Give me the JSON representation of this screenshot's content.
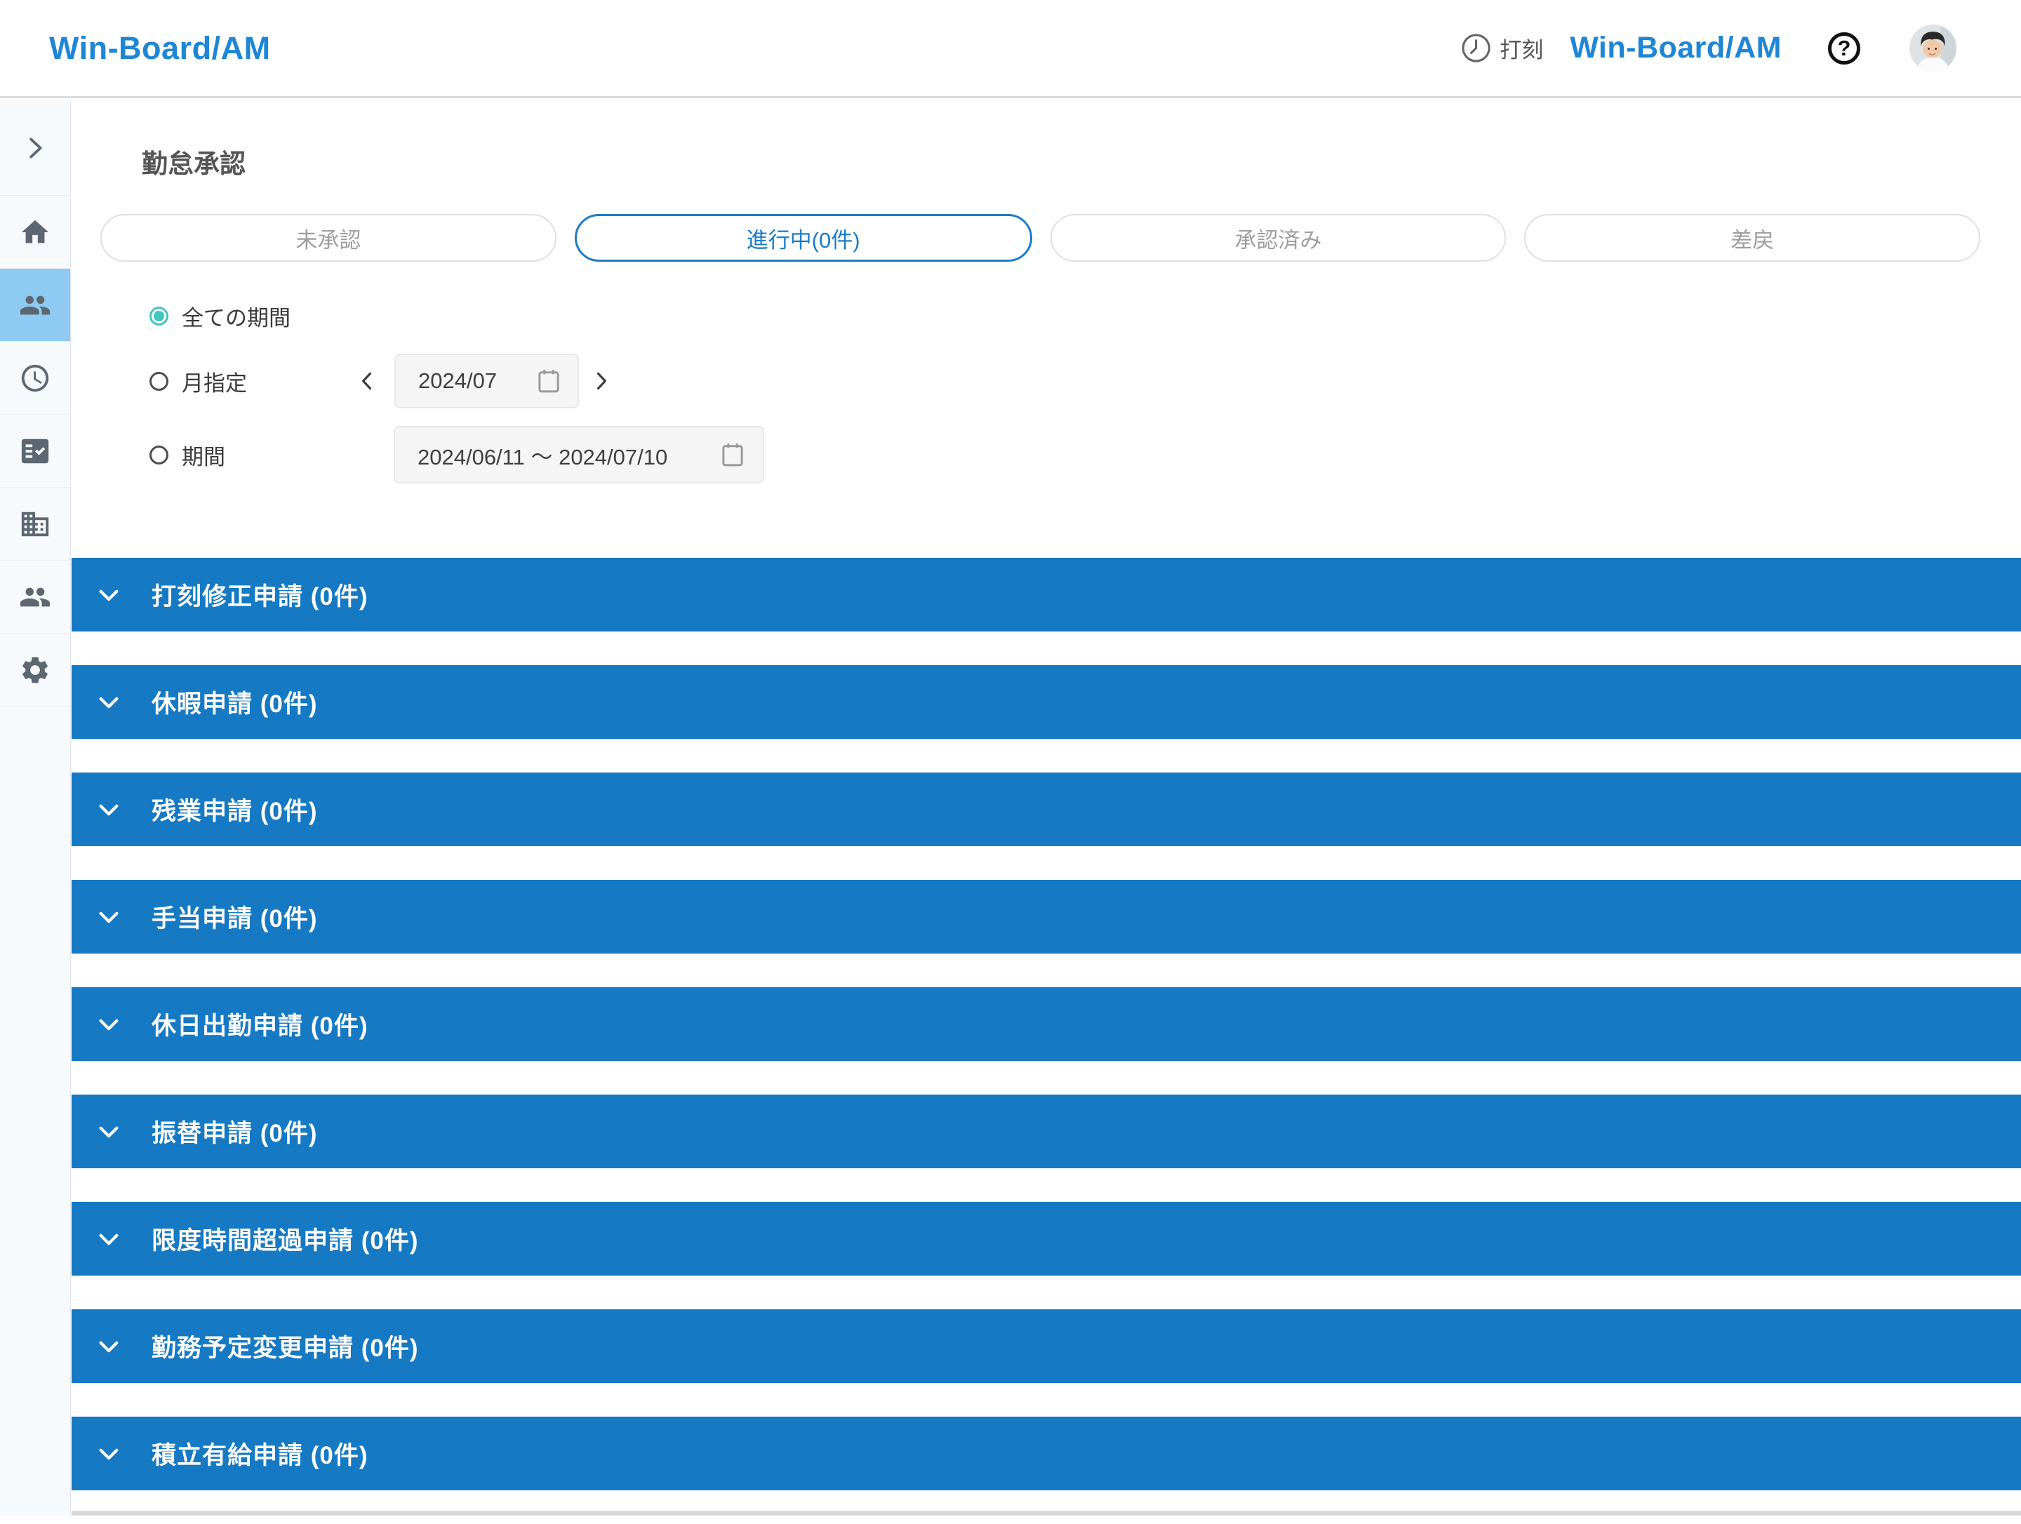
{
  "colors": {
    "accent_blue": "#1B7CC9",
    "bar_blue": "#1579C4",
    "logo_blue": "#1E86D6",
    "teal": "#3FC8C0",
    "sidebar_active": "#8ECAF1",
    "header_border": "#DBDBDB"
  },
  "header": {
    "logo": "Win-Board/AM",
    "punch_label": "打刻",
    "app_name": "Win-Board/AM",
    "help_glyph": "?",
    "icons": [
      "clock-icon",
      "help-icon",
      "user-avatar"
    ]
  },
  "sidebar": {
    "items": [
      {
        "icon": "chevron-right-icon",
        "name": "expand-menu",
        "active": false
      },
      {
        "icon": "home-icon",
        "name": "home",
        "active": false
      },
      {
        "icon": "people-icon",
        "name": "attendance-approval",
        "active": true
      },
      {
        "icon": "clock-icon",
        "name": "time-management",
        "active": false
      },
      {
        "icon": "fact-check-icon",
        "name": "applications",
        "active": false
      },
      {
        "icon": "building-icon",
        "name": "company",
        "active": false
      },
      {
        "icon": "people-icon",
        "name": "members",
        "active": false
      },
      {
        "icon": "gear-icon",
        "name": "settings",
        "active": false
      }
    ]
  },
  "page": {
    "title": "勤怠承認"
  },
  "tabs": [
    {
      "label": "未承認",
      "active": false
    },
    {
      "label": "進行中(0件)",
      "active": true
    },
    {
      "label": "承認済み",
      "active": false
    },
    {
      "label": "差戻",
      "active": false
    }
  ],
  "filters": {
    "all_period_label": "全ての期間",
    "month_label": "月指定",
    "month_value": "2024/07",
    "range_label": "期間",
    "range_value": "2024/06/11 ～ 2024/07/10",
    "selected": "all_period"
  },
  "sections": [
    {
      "text": "打刻修正申請 (0件)"
    },
    {
      "text": "休暇申請 (0件)"
    },
    {
      "text": "残業申請 (0件)"
    },
    {
      "text": "手当申請 (0件)"
    },
    {
      "text": "休日出勤申請 (0件)"
    },
    {
      "text": "振替申請 (0件)"
    },
    {
      "text": "限度時間超過申請 (0件)"
    },
    {
      "text": "勤務予定変更申請 (0件)"
    },
    {
      "text": "積立有給申請 (0件)"
    }
  ]
}
